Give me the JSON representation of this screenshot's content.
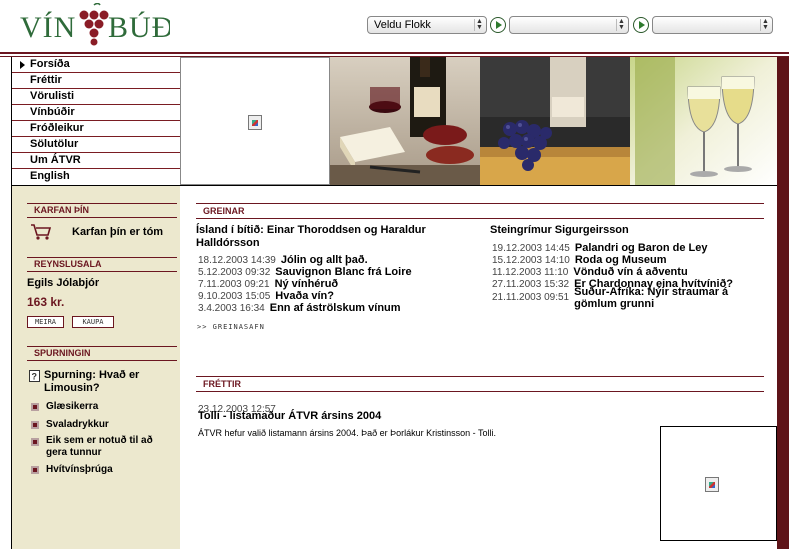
{
  "header": {
    "logo_text": "VÍNBÚÐ",
    "select1": "Veldu Flokk",
    "select2": "",
    "select3": ""
  },
  "nav": {
    "items": [
      {
        "label": "Forsíða"
      },
      {
        "label": "Fréttir"
      },
      {
        "label": "Vörulisti"
      },
      {
        "label": "Vínbúðir"
      },
      {
        "label": "Fróðleikur"
      },
      {
        "label": "Sölutölur"
      },
      {
        "label": "Um ÁTVR"
      },
      {
        "label": "English"
      }
    ]
  },
  "sidebar": {
    "cart_head": "KARFAN ÞÍN",
    "cart_label": "Karfan þín er tóm",
    "trial_head": "REYNSLUSALA",
    "trial_product": "Egils Jólabjór",
    "trial_price": "163 kr.",
    "btn_more": "MEIRA",
    "btn_buy": "KAUPA",
    "question_head": "SPURNINGIN",
    "question": "Spurning: Hvað er Limousin?",
    "answers": [
      "Glæsikerra",
      "Svaladrykkur",
      "Eik sem er notuð til að gera tunnur",
      "Hvítvínsþrúga"
    ]
  },
  "articles": {
    "head": "GREINAR",
    "left_title": "Ísland í bítið: Einar Thoroddsen og Haraldur Halldórsson",
    "left_rows": [
      {
        "date": "18.12.2003 14:39",
        "title": "Jólin og allt það."
      },
      {
        "date": "5.12.2003 09:32",
        "title": "Sauvignon Blanc frá Loire"
      },
      {
        "date": "7.11.2003 09:21",
        "title": "Ný vínhéruð"
      },
      {
        "date": "9.10.2003 15:05",
        "title": "Hvaða vín?"
      },
      {
        "date": "3.4.2003 16:34",
        "title": "Enn af áströlskum vínum"
      }
    ],
    "right_title": "Steingrímur Sigurgeirsson",
    "right_rows": [
      {
        "date": "19.12.2003 14:45",
        "title": "Palandri og Baron de Ley"
      },
      {
        "date": "15.12.2003 14:10",
        "title": "Roda og Museum"
      },
      {
        "date": "11.12.2003 11:10",
        "title": "Vönduð vín á aðventu"
      },
      {
        "date": "27.11.2003 15:32",
        "title": "Er Chardonnay eina hvítvínið?"
      },
      {
        "date": "21.11.2003 09:51",
        "title": "Suður-Afríka: Nýir straumar á gömlum grunni"
      }
    ],
    "archive_link": ">> GREINASAFN"
  },
  "news": {
    "head": "FRÉTTIR",
    "date": "23.12.2003 12:57",
    "title": "Tolli - listamaður ÁTVR ársins 2004",
    "body": "ÁTVR hefur valið listamann ársins 2004. Það er Þorlákur Kristinsson - Tolli."
  },
  "colors": {
    "maroon": "#6b1620",
    "sidebar_bg": "#ece8ce",
    "logo_green": "#2f6b3a",
    "grape": "#8a1c26"
  }
}
